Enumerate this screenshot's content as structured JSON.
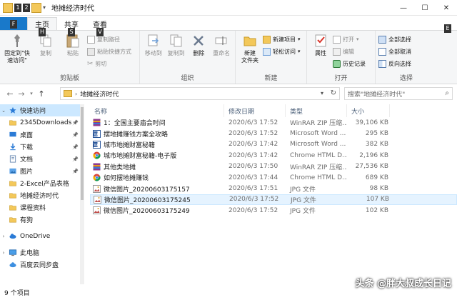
{
  "window": {
    "title": "地摊经济时代",
    "controls": {
      "minimize": "—",
      "maximize": "☐",
      "close": "✕"
    }
  },
  "qat_keytips": [
    "1",
    "2"
  ],
  "ribbon_tabs": [
    {
      "label": "文件",
      "keytip": "F"
    },
    {
      "label": "主页",
      "keytip": "H"
    },
    {
      "label": "共享",
      "keytip": "S"
    },
    {
      "label": "查看",
      "keytip": "V"
    }
  ],
  "help_keytip": "E",
  "ribbon": {
    "clipboard": {
      "group_label": "剪贴板",
      "pin": "固定到\"快\n速访问\"",
      "copy": "复制",
      "paste": "粘贴",
      "copy_path": "复制路径",
      "paste_shortcut": "粘贴快捷方式",
      "cut": "剪切"
    },
    "organize": {
      "group_label": "组织",
      "move_to": "移动到",
      "copy_to": "复制到",
      "delete": "删除",
      "rename": "重命名"
    },
    "new": {
      "group_label": "新建",
      "new_folder": "新建\n文件夹",
      "new_item": "新建项目",
      "easy_access": "轻松访问"
    },
    "open": {
      "group_label": "打开",
      "properties": "属性",
      "open": "打开",
      "edit": "编辑",
      "history": "历史记录"
    },
    "select": {
      "group_label": "选择",
      "select_all": "全部选择",
      "select_none": "全部取消",
      "invert": "反向选择"
    }
  },
  "address": {
    "path": "地摊经济时代",
    "search_placeholder": "搜索\"地摊经济时代\""
  },
  "nav": {
    "quick_access": "快速访问",
    "items": [
      {
        "label": "2345Downloads",
        "icon": "folder",
        "pinned": true
      },
      {
        "label": "桌面",
        "icon": "desktop",
        "pinned": true
      },
      {
        "label": "下载",
        "icon": "download",
        "pinned": true
      },
      {
        "label": "文档",
        "icon": "documents",
        "pinned": true
      },
      {
        "label": "图片",
        "icon": "pictures",
        "pinned": true
      },
      {
        "label": "2-Excel产品表格",
        "icon": "folder",
        "pinned": false
      },
      {
        "label": "地摊经济时代",
        "icon": "folder",
        "pinned": false
      },
      {
        "label": "课程资料",
        "icon": "folder",
        "pinned": false
      },
      {
        "label": "有狗",
        "icon": "folder",
        "pinned": false
      }
    ],
    "onedrive": "OneDrive",
    "this_pc": "此电脑",
    "baidu": "百度云同步盘"
  },
  "columns": {
    "name": "名称",
    "date": "修改日期",
    "type": "类型",
    "size": "大小"
  },
  "files": [
    {
      "name": "1：全国主要庙会时间",
      "date": "2020/6/3 17:52",
      "type": "WinRAR ZIP 压缩...",
      "size": "39,106 KB",
      "icon": "zip"
    },
    {
      "name": "摆地摊赚钱方案全攻略",
      "date": "2020/6/3 17:52",
      "type": "Microsoft Word ...",
      "size": "295 KB",
      "icon": "word"
    },
    {
      "name": "城市地摊财富秘籍",
      "date": "2020/6/3 17:42",
      "type": "Microsoft Word ...",
      "size": "382 KB",
      "icon": "word"
    },
    {
      "name": "城市地摊财富秘籍-电子版",
      "date": "2020/6/3 17:42",
      "type": "Chrome HTML D...",
      "size": "2,196 KB",
      "icon": "chrome"
    },
    {
      "name": "其他类地摊",
      "date": "2020/6/3 17:50",
      "type": "WinRAR ZIP 压缩...",
      "size": "27,536 KB",
      "icon": "zip"
    },
    {
      "name": "如何摆地摊赚钱",
      "date": "2020/6/3 17:44",
      "type": "Chrome HTML D...",
      "size": "689 KB",
      "icon": "chrome"
    },
    {
      "name": "微信图片_20200603175157",
      "date": "2020/6/3 17:51",
      "type": "JPG 文件",
      "size": "98 KB",
      "icon": "jpg"
    },
    {
      "name": "微信图片_20200603175245",
      "date": "2020/6/3 17:52",
      "type": "JPG 文件",
      "size": "107 KB",
      "icon": "jpg",
      "selected": true
    },
    {
      "name": "微信图片_20200603175249",
      "date": "2020/6/3 17:52",
      "type": "JPG 文件",
      "size": "102 KB",
      "icon": "jpg"
    }
  ],
  "status": {
    "count": "9 个项目"
  },
  "watermark": "头条 @胖大叔成长日记"
}
